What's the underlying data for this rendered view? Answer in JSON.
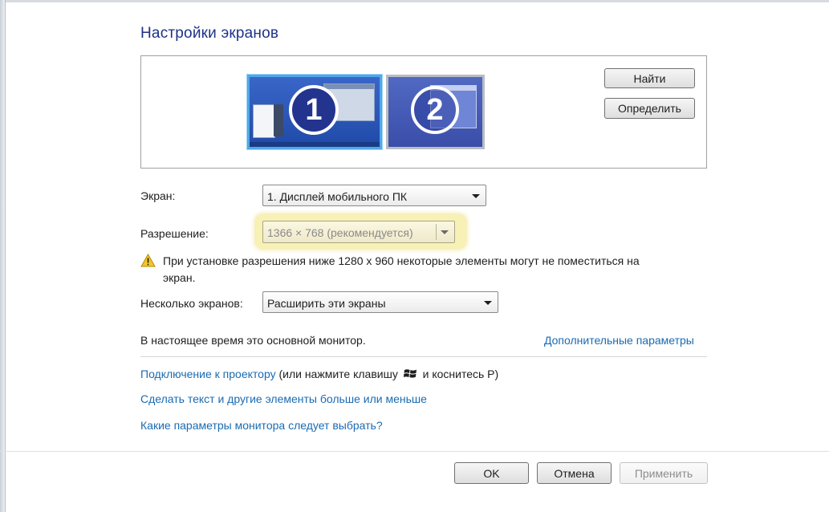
{
  "page_title": "Настройки экранов",
  "buttons": {
    "find": "Найти",
    "identify": "Определить",
    "ok": "OK",
    "cancel": "Отмена",
    "apply": "Применить"
  },
  "monitors": [
    {
      "number": "1",
      "selected": true
    },
    {
      "number": "2",
      "selected": false
    }
  ],
  "display": {
    "label": "Экран:",
    "value": "1. Дисплей мобильного ПК"
  },
  "resolution": {
    "label": "Разрешение:",
    "value": "1366 × 768 (рекомендуется)"
  },
  "warning": {
    "icon": "warning-icon",
    "line1": "При установке разрешения ниже 1280 x 960 некоторые элементы могут не поместиться на",
    "line2": "экран."
  },
  "multiple": {
    "label": "Несколько экранов:",
    "value": "Расширить эти экраны"
  },
  "primary_text": "В настоящее время это основной монитор.",
  "advanced_link": "Дополнительные параметры",
  "projector": {
    "link": "Подключение к проектору",
    "text_before": "(или нажмите клавишу",
    "icon": "windows-logo-icon",
    "text_after": "и коснитесь P)"
  },
  "links": {
    "text_size": "Сделать текст и другие элементы больше или меньше",
    "which_settings": "Какие параметры монитора следует выбрать?"
  },
  "colors": {
    "title": "#1e3287",
    "link": "#1a6bb3",
    "highlight": "#fbf3b0"
  }
}
